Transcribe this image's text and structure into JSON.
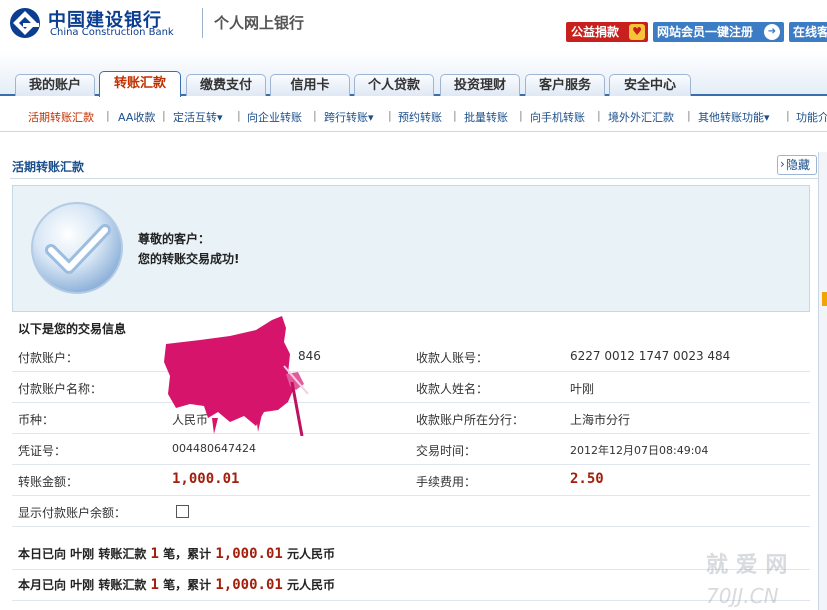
{
  "header": {
    "bank_name_cn": "中国建设银行",
    "bank_name_en": "China Construction Bank",
    "subtitle": "个人网上银行",
    "donate_label": "公益捐款",
    "member_label": "网站会员一键注册",
    "online_label": "在线客",
    "brand_color": "#0b3d91"
  },
  "tabs": [
    {
      "label": "我的账户",
      "active": false
    },
    {
      "label": "转账汇款",
      "active": true
    },
    {
      "label": "缴费支付",
      "active": false
    },
    {
      "label": "信用卡",
      "active": false
    },
    {
      "label": "个人贷款",
      "active": false
    },
    {
      "label": "投资理财",
      "active": false
    },
    {
      "label": "客户服务",
      "active": false
    },
    {
      "label": "安全中心",
      "active": false
    }
  ],
  "subnav": [
    {
      "label": "活期转账汇款",
      "active": true
    },
    {
      "label": "AA收款",
      "active": false
    },
    {
      "label": "定活互转▾",
      "active": false
    },
    {
      "label": "向企业转账",
      "active": false
    },
    {
      "label": "跨行转账▾",
      "active": false
    },
    {
      "label": "预约转账",
      "active": false
    },
    {
      "label": "批量转账",
      "active": false
    },
    {
      "label": "向手机转账",
      "active": false
    },
    {
      "label": "境外外汇汇款",
      "active": false
    },
    {
      "label": "其他转账功能▾",
      "active": false
    },
    {
      "label": "功能介",
      "active": false
    }
  ],
  "section": {
    "title": "活期转账汇款",
    "hide_label": "隐藏"
  },
  "success": {
    "greeting": "尊敬的客户：",
    "message": "您的转账交易成功!"
  },
  "info": {
    "header": "以下是您的交易信息",
    "payer_account_label": "付款账户：",
    "payer_account_value": "846",
    "payee_account_label": "收款人账号：",
    "payee_account_value": "6227 0012 1747 0023 484",
    "payer_name_label": "付款账户名称：",
    "payee_name_label": "收款人姓名：",
    "payee_name_value": "叶刚",
    "currency_label": "币种：",
    "currency_value": "人民币",
    "payee_branch_label": "收款账户所在分行：",
    "payee_branch_value": "上海市分行",
    "voucher_label": "凭证号：",
    "voucher_value": "004480647424",
    "time_label": "交易时间：",
    "time_value": "2012年12月07日08:49:04",
    "amount_label": "转账金额：",
    "amount_value": "1,000.01",
    "fee_label": "手续费用：",
    "fee_value": "2.50",
    "show_balance_label": "显示付款账户余额：",
    "show_balance_checked": false
  },
  "summary": {
    "today_prefix": "本日已向 叶刚 转账汇款",
    "month_prefix": "本月已向 叶刚 转账汇款",
    "count": "1",
    "count_unit": "笔，累计",
    "total": "1,000.01",
    "currency_unit": "元人民币"
  },
  "watermark": {
    "line1": "就 爱 网",
    "line2": "70JJ.CN"
  }
}
